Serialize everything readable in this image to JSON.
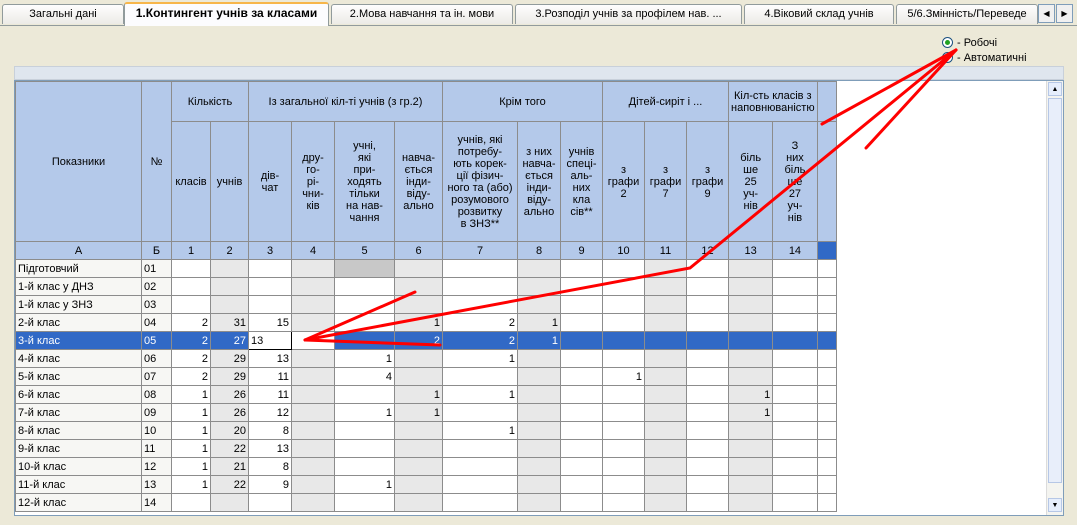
{
  "tabs": [
    {
      "label": "Загальні дані"
    },
    {
      "label": "1.Контингент учнів за класами"
    },
    {
      "label": "2.Мова навчання та ін. мови"
    },
    {
      "label": "3.Розподіл учнів за профілем нав. ..."
    },
    {
      "label": "4.Віковий склад учнів"
    },
    {
      "label": "5/6.Змінність/Переведе"
    }
  ],
  "radio": {
    "option1": "- Робочі",
    "option2": "- Автоматичні"
  },
  "header": {
    "indicators": "Показники",
    "no": "№",
    "kilkist": "Кількість",
    "klasiv": "класів",
    "uchniv": "учнів",
    "iz_zag": "Із загальної кіл-ті учнів (з гр.2)",
    "divchat": "дів-\nчат",
    "drugorichnykiv": "дру-\nго-\nрі-\nчни-\nків",
    "pryhodyat": "учні,\nякі\nпри-\nходять\nтільки\nна нав-\nчання",
    "navchaetsya": "навча-\nється\nінди-\nвіду-\nально",
    "krim_toho": "Крім того",
    "potrebuyut": "учнів, які\nпотребу-\nють корек-\nції фізич-\nного та (або)\nрозумового\nрозвитку\nв ЗНЗ**",
    "z_nyh": "з них\nнавча-\nється\nінди-\nвіду-\nально",
    "uchniv_spec": "учнів\nспеці-\nаль-\nних\nкла\nсів**",
    "ditey_syrit": "Дітей-сиріт і ...",
    "z_grafy_2": "з\nграфи\n2",
    "z_grafy_7": "з\nграфи\n7",
    "z_grafy_9": "з\nграфи\n9",
    "kilst_klasiv": "Кіл-сть класів з\nнаповнюваністю",
    "bilshe_25": "біль\nше\n25\nуч-\nнів",
    "z_nyh_27": "З\nних\nбіль\nше\n27\nуч-\nнів"
  },
  "colnums": [
    "А",
    "Б",
    "1",
    "2",
    "3",
    "4",
    "5",
    "6",
    "7",
    "8",
    "9",
    "10",
    "11",
    "12",
    "13",
    "14"
  ],
  "rows": [
    {
      "label": "Підготовчий",
      "no": "01",
      "v": [
        "",
        "",
        "",
        "",
        "",
        "",
        "",
        "",
        "",
        "",
        "",
        "",
        "",
        ""
      ]
    },
    {
      "label": "1-й клас у ДНЗ",
      "no": "02",
      "v": [
        "",
        "",
        "",
        "",
        "",
        "",
        "",
        "",
        "",
        "",
        "",
        "",
        "",
        ""
      ]
    },
    {
      "label": "1-й клас у ЗНЗ",
      "no": "03",
      "v": [
        "",
        "",
        "",
        "",
        "",
        "",
        "",
        "",
        "",
        "",
        "",
        "",
        "",
        ""
      ]
    },
    {
      "label": "2-й клас",
      "no": "04",
      "v": [
        "2",
        "31",
        "15",
        "",
        "",
        "1",
        "2",
        "1",
        "",
        "",
        "",
        "",
        "",
        ""
      ]
    },
    {
      "label": "3-й клас",
      "no": "05",
      "v": [
        "2",
        "27",
        "13",
        "",
        "",
        "2",
        "2",
        "1",
        "",
        "",
        "",
        "",
        "",
        ""
      ]
    },
    {
      "label": "4-й клас",
      "no": "06",
      "v": [
        "2",
        "29",
        "13",
        "",
        "1",
        "",
        "1",
        "",
        "",
        "",
        "",
        "",
        "",
        ""
      ]
    },
    {
      "label": "5-й клас",
      "no": "07",
      "v": [
        "2",
        "29",
        "11",
        "",
        "4",
        "",
        "",
        "",
        "",
        "1",
        "",
        "",
        "",
        ""
      ]
    },
    {
      "label": "6-й клас",
      "no": "08",
      "v": [
        "1",
        "26",
        "11",
        "",
        "",
        "1",
        "1",
        "",
        "",
        "",
        "",
        "",
        "1",
        ""
      ]
    },
    {
      "label": "7-й клас",
      "no": "09",
      "v": [
        "1",
        "26",
        "12",
        "",
        "1",
        "1",
        "",
        "",
        "",
        "",
        "",
        "",
        "1",
        ""
      ]
    },
    {
      "label": "8-й клас",
      "no": "10",
      "v": [
        "1",
        "20",
        "8",
        "",
        "",
        "",
        "1",
        "",
        "",
        "",
        "",
        "",
        "",
        ""
      ]
    },
    {
      "label": "9-й клас",
      "no": "11",
      "v": [
        "1",
        "22",
        "13",
        "",
        "",
        "",
        "",
        "",
        "",
        "",
        "",
        "",
        "",
        ""
      ]
    },
    {
      "label": "10-й клас",
      "no": "12",
      "v": [
        "1",
        "21",
        "8",
        "",
        "",
        "",
        "",
        "",
        "",
        "",
        "",
        "",
        "",
        ""
      ]
    },
    {
      "label": "11-й клас",
      "no": "13",
      "v": [
        "1",
        "22",
        "9",
        "",
        "1",
        "",
        "",
        "",
        "",
        "",
        "",
        "",
        "",
        ""
      ]
    },
    {
      "label": "12-й клас",
      "no": "14",
      "v": [
        "",
        "",
        "",
        "",
        "",
        "",
        "",
        "",
        "",
        "",
        "",
        "",
        "",
        ""
      ]
    }
  ],
  "annotation_color": "#ff0000",
  "selection_color": "#3169c6",
  "header_color": "#b4c9ea"
}
